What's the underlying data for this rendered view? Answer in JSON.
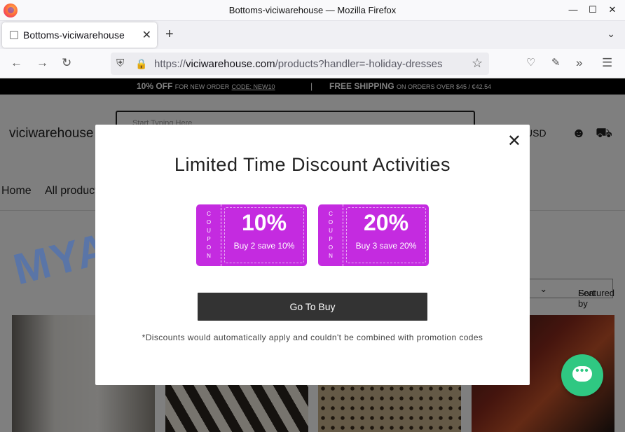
{
  "window": {
    "title": "Bottoms-viciwarehouse — Mozilla Firefox"
  },
  "tab": {
    "title": "Bottoms-viciwarehouse"
  },
  "url": {
    "domain": "viciwarehouse.com",
    "prefix": "https://",
    "path": "/products?handler=-holiday-dresses"
  },
  "promo": {
    "offer": "10% OFF",
    "offer_note": "FOR NEW ORDER",
    "code": "CODE: NEW10",
    "separator": "|",
    "shipping": "FREE SHIPPING",
    "shipping_note": "ON ORDERS OVER $45 / €42.54"
  },
  "header": {
    "brand": "viciwarehouse",
    "search_placeholder": "Start Typing Here",
    "currency": "USD"
  },
  "menu": {
    "home": "Home",
    "all": "All products"
  },
  "sort": {
    "label": "Sort by",
    "value": "Featured"
  },
  "modal": {
    "title": "Limited Time Discount Activities",
    "coupons": [
      {
        "label": "COUPON",
        "percent": "10%",
        "desc": "Buy 2 save 10%"
      },
      {
        "label": "COUPON",
        "percent": "20%",
        "desc": "Buy 3 save 20%"
      }
    ],
    "button": "Go To Buy",
    "note": "*Discounts would automatically apply and couldn't be combined with promotion codes"
  },
  "watermark": "MYANTISPYWARE.COM",
  "colors": {
    "coupon": "#c42be0",
    "chat": "#2fc882",
    "button": "#333333"
  }
}
